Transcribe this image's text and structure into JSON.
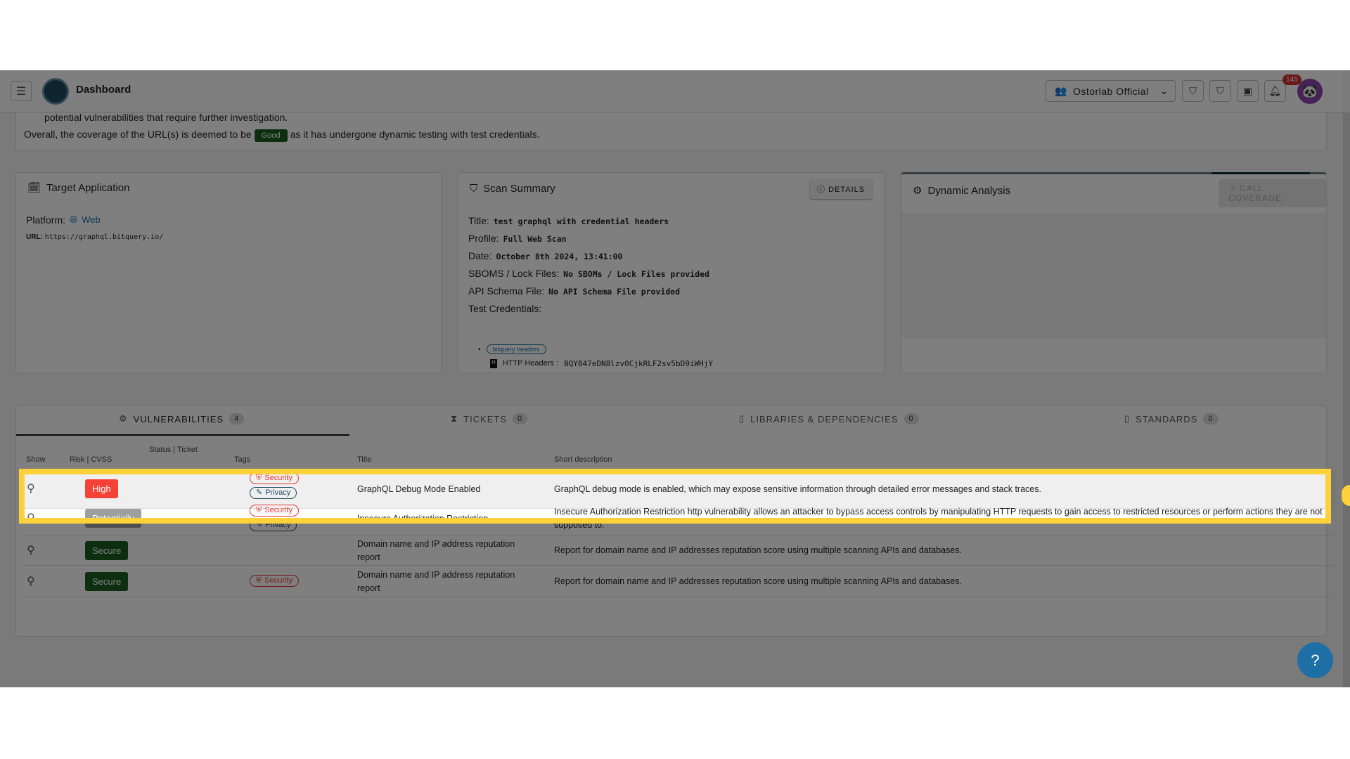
{
  "header": {
    "title": "Dashboard",
    "org": "Ostorlab Official",
    "notifications": "145",
    "icons": [
      "menu-icon",
      "add-shield-icon",
      "shield-icon",
      "ticket-icon",
      "bell-icon"
    ]
  },
  "coverage": {
    "partial_line": "potential vulnerabilities that require further investigation.",
    "prefix": "Overall, the coverage of the URL(s) is deemed to be",
    "badge": "Good",
    "suffix": "as it has undergone dynamic testing with test credentials."
  },
  "target": {
    "title": "Target Application",
    "platform_label": "Platform:",
    "platform": "Web",
    "url_label": "URL:",
    "url": "https://graphql.bitquery.io/"
  },
  "scan": {
    "title": "Scan Summary",
    "details": "DETAILS",
    "fields": [
      {
        "label": "Title:",
        "value": "test graphql with credential headers"
      },
      {
        "label": "Profile:",
        "value": "Full Web Scan"
      },
      {
        "label": "Date:",
        "value": "October 8th 2024, 13:41:00"
      },
      {
        "label": "SBOMS / Lock Files:",
        "value": "No SBOMs / Lock Files provided"
      },
      {
        "label": "API Schema File:",
        "value": "No API Schema File provided"
      }
    ],
    "cred_label": "Test Credentials:",
    "cred_name": "bitquery headers",
    "cred_key": "HTTP Headers :",
    "cred_value": "BQY847eDN8lzv0CjkRLF2sv5bD9iWHjY"
  },
  "dynamic": {
    "title": "Dynamic Analysis",
    "call_coverage": "CALL COVERAGE"
  },
  "tabs": [
    {
      "label": "VULNERABILITIES",
      "count": "4"
    },
    {
      "label": "TICKETS",
      "count": "0"
    },
    {
      "label": "LIBRARIES & DEPENDENCIES",
      "count": "0"
    },
    {
      "label": "STANDARDS",
      "count": "0"
    }
  ],
  "table": {
    "headers": [
      "Show",
      "Risk | CVSS",
      "Status | Ticket",
      "Tags",
      "Title",
      "Short description"
    ],
    "rows": [
      {
        "risk": "High",
        "risk_color": "#f44336",
        "tags": [
          "Security",
          "Privacy"
        ],
        "title": "GraphQL Debug Mode Enabled",
        "desc": "GraphQL debug mode is enabled, which may expose sensitive information through detailed error messages and stack traces."
      },
      {
        "risk": "Potentially",
        "risk_color": "#9e9e9e",
        "tags": [
          "Security",
          "Privacy"
        ],
        "title": "Insecure Authorization Restriction",
        "desc": "Insecure Authorization Restriction http vulnerability allows an attacker to bypass access controls by manipulating HTTP requests to gain access to restricted resources or perform actions they are not supposed to."
      },
      {
        "risk": "Secure",
        "risk_color": "#1b5e20",
        "tags": [],
        "title": "Domain name and IP address reputation report",
        "desc": "Report for domain name and IP addresses reputation score using multiple scanning APIs and databases."
      },
      {
        "risk": "Secure",
        "risk_color": "#1b5e20",
        "tags": [
          "Security"
        ],
        "title": "Domain name and IP address reputation report",
        "desc": "Report for domain name and IP addresses reputation score using multiple scanning APIs and databases."
      }
    ]
  },
  "help": "?"
}
